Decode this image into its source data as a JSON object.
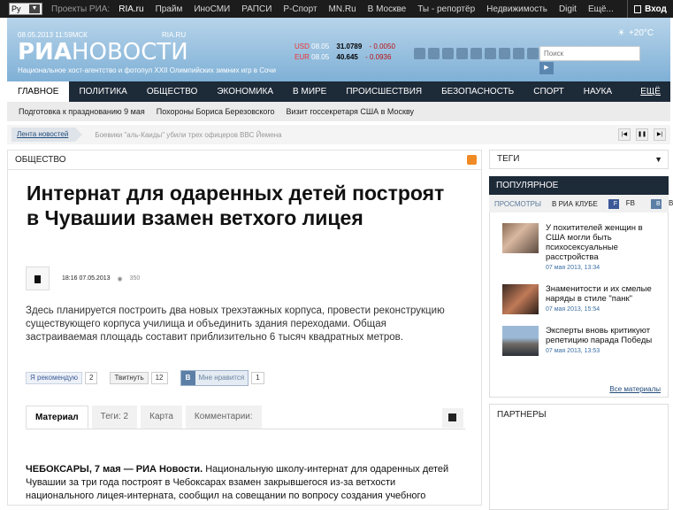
{
  "topbar": {
    "lang": "Ру",
    "projects_label": "Проекты РИА:",
    "links": [
      "RIA.ru",
      "Прайм",
      "ИноСМИ",
      "РАПСИ",
      "Р-Спорт",
      "MN.Ru",
      "В Москве",
      "Ты - репортёр",
      "Недвижимость",
      "Digit",
      "Ещё..."
    ],
    "login": "Вход"
  },
  "header": {
    "date": "08.05.2013  11:59МСК",
    "logo_a": "РИА",
    "logo_b": "НОВОСТИ",
    "logo_domain": "RIA.RU",
    "tagline": "Национальное хост-агентство и фотопул XXII Олимпийских зимних игр в Сочи",
    "rates": [
      {
        "cur": "USD",
        "date": "08.05",
        "value": "31.0789",
        "delta": "- 0.0050"
      },
      {
        "cur": "EUR",
        "date": "08.05",
        "value": "40.645",
        "delta": "- 0.0936"
      }
    ],
    "search_placeholder": "Поиск",
    "search_button": "▶",
    "weather": "+20°C"
  },
  "nav": {
    "items": [
      "Главное",
      "Политика",
      "Общество",
      "Экономика",
      "В мире",
      "Происшествия",
      "Безопасность",
      "Спорт",
      "Наука"
    ],
    "more": "Ещё"
  },
  "subnav": [
    "Подготовка к празднованию 9 мая",
    "Похороны Бориса Березовского",
    "Визит госсекретаря США в Москву"
  ],
  "ticker": {
    "label": "Лента новостей",
    "text": "Боевики \"аль-Каиды\" убили трех офицеров ВВС Йемена"
  },
  "article": {
    "section": "Общество",
    "title": "Интернат для одаренных детей построят в Чувашии взамен ветхого лицея",
    "time": "18:16 07.05.2013",
    "views": "350",
    "lead": "Здесь планируется построить два новых трехэтажных корпуса, провести реконструкцию существующего корпуса училища и объединить здания переходами. Общая застраиваемая площадь составит приблизительно 6 тысяч квадратных метров.",
    "share": {
      "fb_label": "Я рекомендую",
      "fb_count": "2",
      "tw_label": "Твитнуть",
      "tw_count": "12",
      "vk_label": "Мне нравится",
      "vk_count": "1"
    },
    "tabs": [
      "Материал",
      "Теги: 2",
      "Карта",
      "Комментарии:"
    ],
    "body_lead": "ЧЕБОКСАРЫ, 7 мая — РИА Новости.",
    "body": " Национальную школу-интернат для одаренных детей Чувашии за три года построят в Чебоксарах взамен закрывшегося из-за ветхости национального лицея-интерната, сообщил на совещании по вопросу создания учебного"
  },
  "sidebar": {
    "tags": "Теги",
    "popular": "Популярное",
    "pop_tabs": {
      "views": "Просмотры",
      "club": "В РИА Клубе",
      "fb": "FB",
      "vk": "ВК"
    },
    "items": [
      {
        "text": "У похитителей женщин в США могли быть психосексуальные расстройства",
        "date": "07 мая 2013, 13:34"
      },
      {
        "text": "Знаменитости и их смелые наряды в стиле \"панк\"",
        "date": "07 мая 2013, 15:54"
      },
      {
        "text": "Эксперты вновь критикуют репетицию парада Победы",
        "date": "07 мая 2013, 13:53"
      }
    ],
    "all_link": "Все материалы",
    "partners": "Партнеры"
  }
}
